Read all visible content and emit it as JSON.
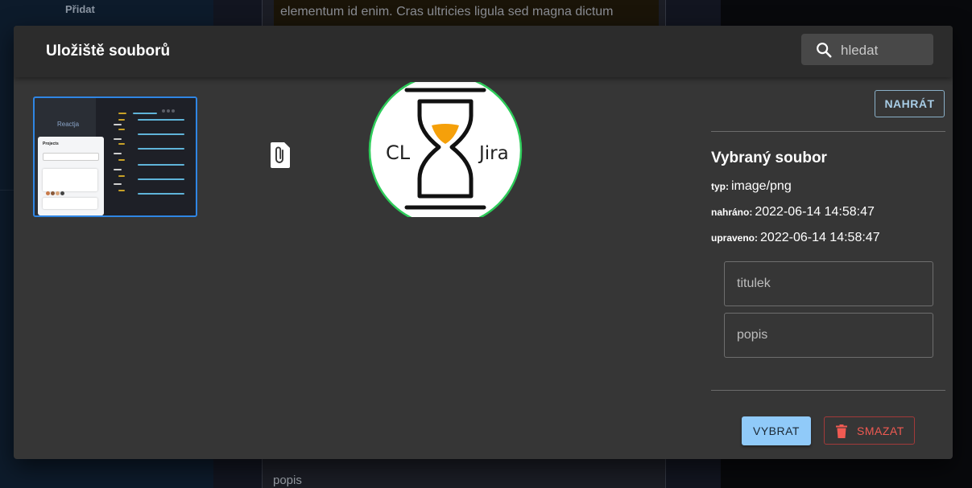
{
  "background": {
    "nav_label": "Přidat",
    "editor_text": "elementum id enim. Cras ultricies ligula sed magna dictum",
    "card_label": "popis"
  },
  "modal": {
    "title": "Uložiště souborů",
    "search": {
      "placeholder": "hledat",
      "icon": "search-icon"
    },
    "files": [
      {
        "kind": "image-thumbnail",
        "selected": true,
        "caption_logo": "Reactja",
        "caption_card": "Projects"
      },
      {
        "kind": "attachment",
        "icon": "paperclip-icon"
      },
      {
        "kind": "image-preview",
        "logo_left": "CL",
        "logo_right": "Jira"
      }
    ],
    "upload_label": "NAHRÁT",
    "selected": {
      "heading": "Vybraný soubor",
      "type_key": "typ:",
      "type_value": "image/png",
      "uploaded_key": "nahráno:",
      "uploaded_value": "2022-06-14 14:58:47",
      "modified_key": "upraveno:",
      "modified_value": "2022-06-14 14:58:47",
      "title_placeholder": "titulek",
      "description_placeholder": "popis"
    },
    "actions": {
      "select_label": "VYBRAT",
      "delete_label": "SMAZAT"
    },
    "colors": {
      "accent": "#90caf9",
      "danger": "#f05a52",
      "selection": "#2f86e4",
      "hourglass": "#f5a00a",
      "ring": "#2ecc5a"
    }
  }
}
